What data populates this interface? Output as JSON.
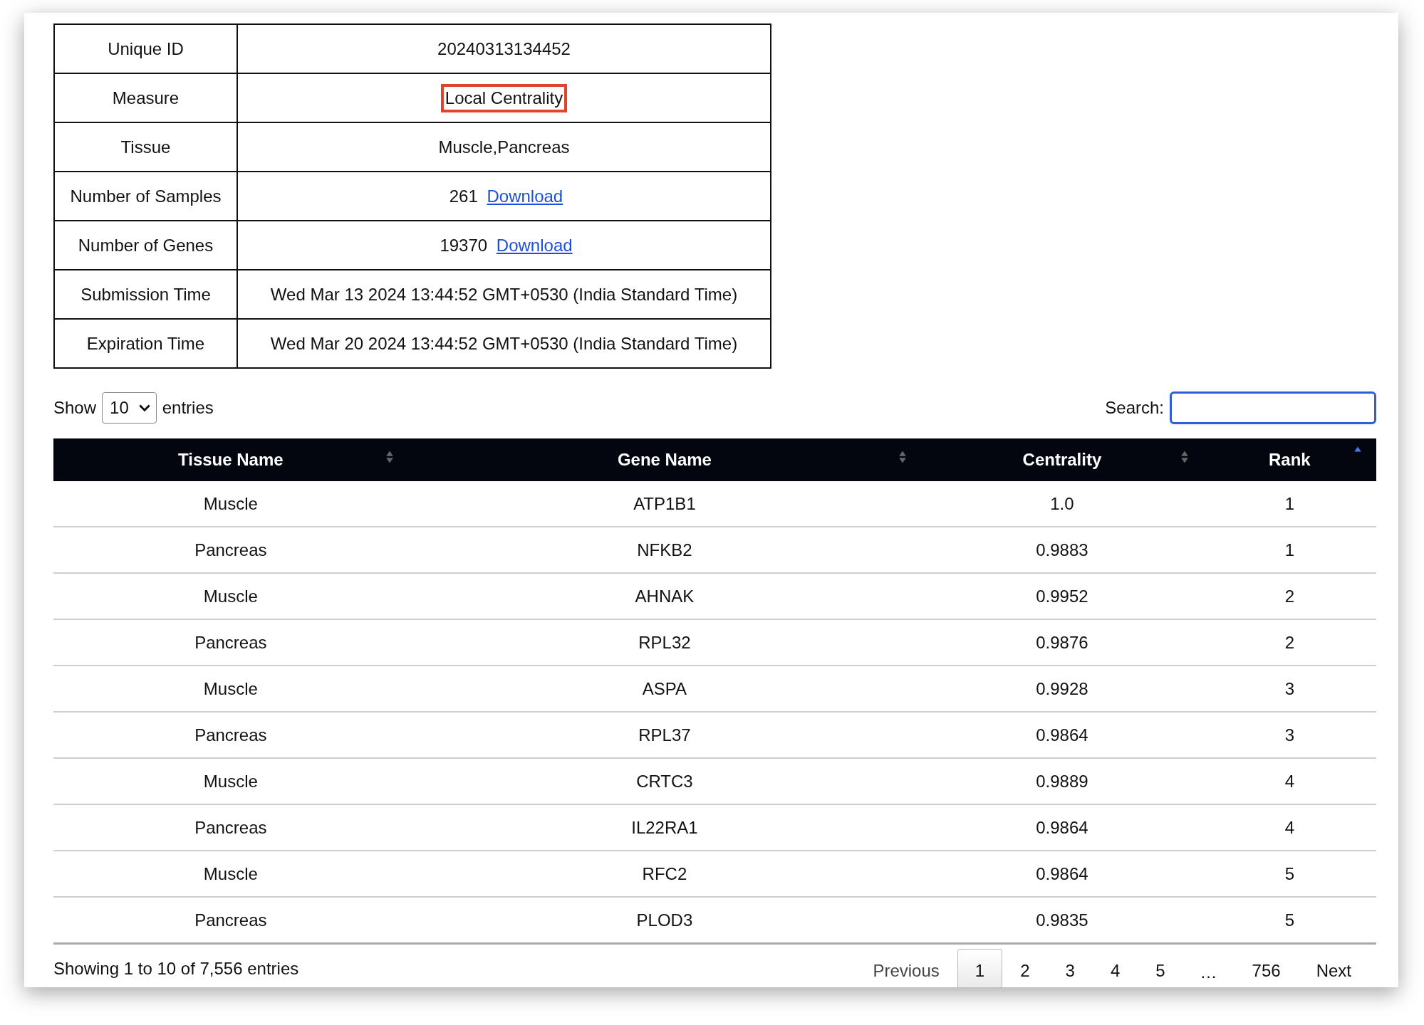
{
  "info_table": [
    {
      "label": "Unique ID",
      "value": "20240313134452"
    },
    {
      "label": "Measure",
      "value": "Local Centrality",
      "highlighted": true
    },
    {
      "label": "Tissue",
      "value": "Muscle,Pancreas"
    },
    {
      "label": "Number of Samples",
      "value": "261",
      "link": "Download"
    },
    {
      "label": "Number of Genes",
      "value": "19370",
      "link": "Download"
    },
    {
      "label": "Submission Time",
      "value": "Wed Mar 13 2024 13:44:52 GMT+0530 (India Standard Time)"
    },
    {
      "label": "Expiration Time",
      "value": "Wed Mar 20 2024 13:44:52 GMT+0530 (India Standard Time)"
    }
  ],
  "length_control": {
    "before": "Show",
    "value": "10",
    "after": "entries"
  },
  "search": {
    "label": "Search:"
  },
  "table": {
    "columns": [
      {
        "label": "Tissue Name",
        "sorted": false
      },
      {
        "label": "Gene Name",
        "sorted": false
      },
      {
        "label": "Centrality",
        "sorted": false
      },
      {
        "label": "Rank",
        "sorted": true
      }
    ],
    "rows": [
      [
        "Muscle",
        "ATP1B1",
        "1.0",
        "1"
      ],
      [
        "Pancreas",
        "NFKB2",
        "0.9883",
        "1"
      ],
      [
        "Muscle",
        "AHNAK",
        "0.9952",
        "2"
      ],
      [
        "Pancreas",
        "RPL32",
        "0.9876",
        "2"
      ],
      [
        "Muscle",
        "ASPA",
        "0.9928",
        "3"
      ],
      [
        "Pancreas",
        "RPL37",
        "0.9864",
        "3"
      ],
      [
        "Muscle",
        "CRTC3",
        "0.9889",
        "4"
      ],
      [
        "Pancreas",
        "IL22RA1",
        "0.9864",
        "4"
      ],
      [
        "Muscle",
        "RFC2",
        "0.9864",
        "5"
      ],
      [
        "Pancreas",
        "PLOD3",
        "0.9835",
        "5"
      ]
    ]
  },
  "info": "Showing 1 to 10 of 7,556 entries",
  "pagination": [
    {
      "label": "Previous",
      "kind": "nav"
    },
    {
      "label": "1",
      "kind": "page",
      "selected": true
    },
    {
      "label": "2",
      "kind": "page",
      "selected": false
    },
    {
      "label": "3",
      "kind": "page",
      "selected": false
    },
    {
      "label": "4",
      "kind": "page",
      "selected": false
    },
    {
      "label": "5",
      "kind": "page",
      "selected": false
    },
    {
      "label": "…",
      "kind": "gap"
    },
    {
      "label": "756",
      "kind": "page",
      "selected": false
    },
    {
      "label": "Next",
      "kind": "nav"
    }
  ]
}
